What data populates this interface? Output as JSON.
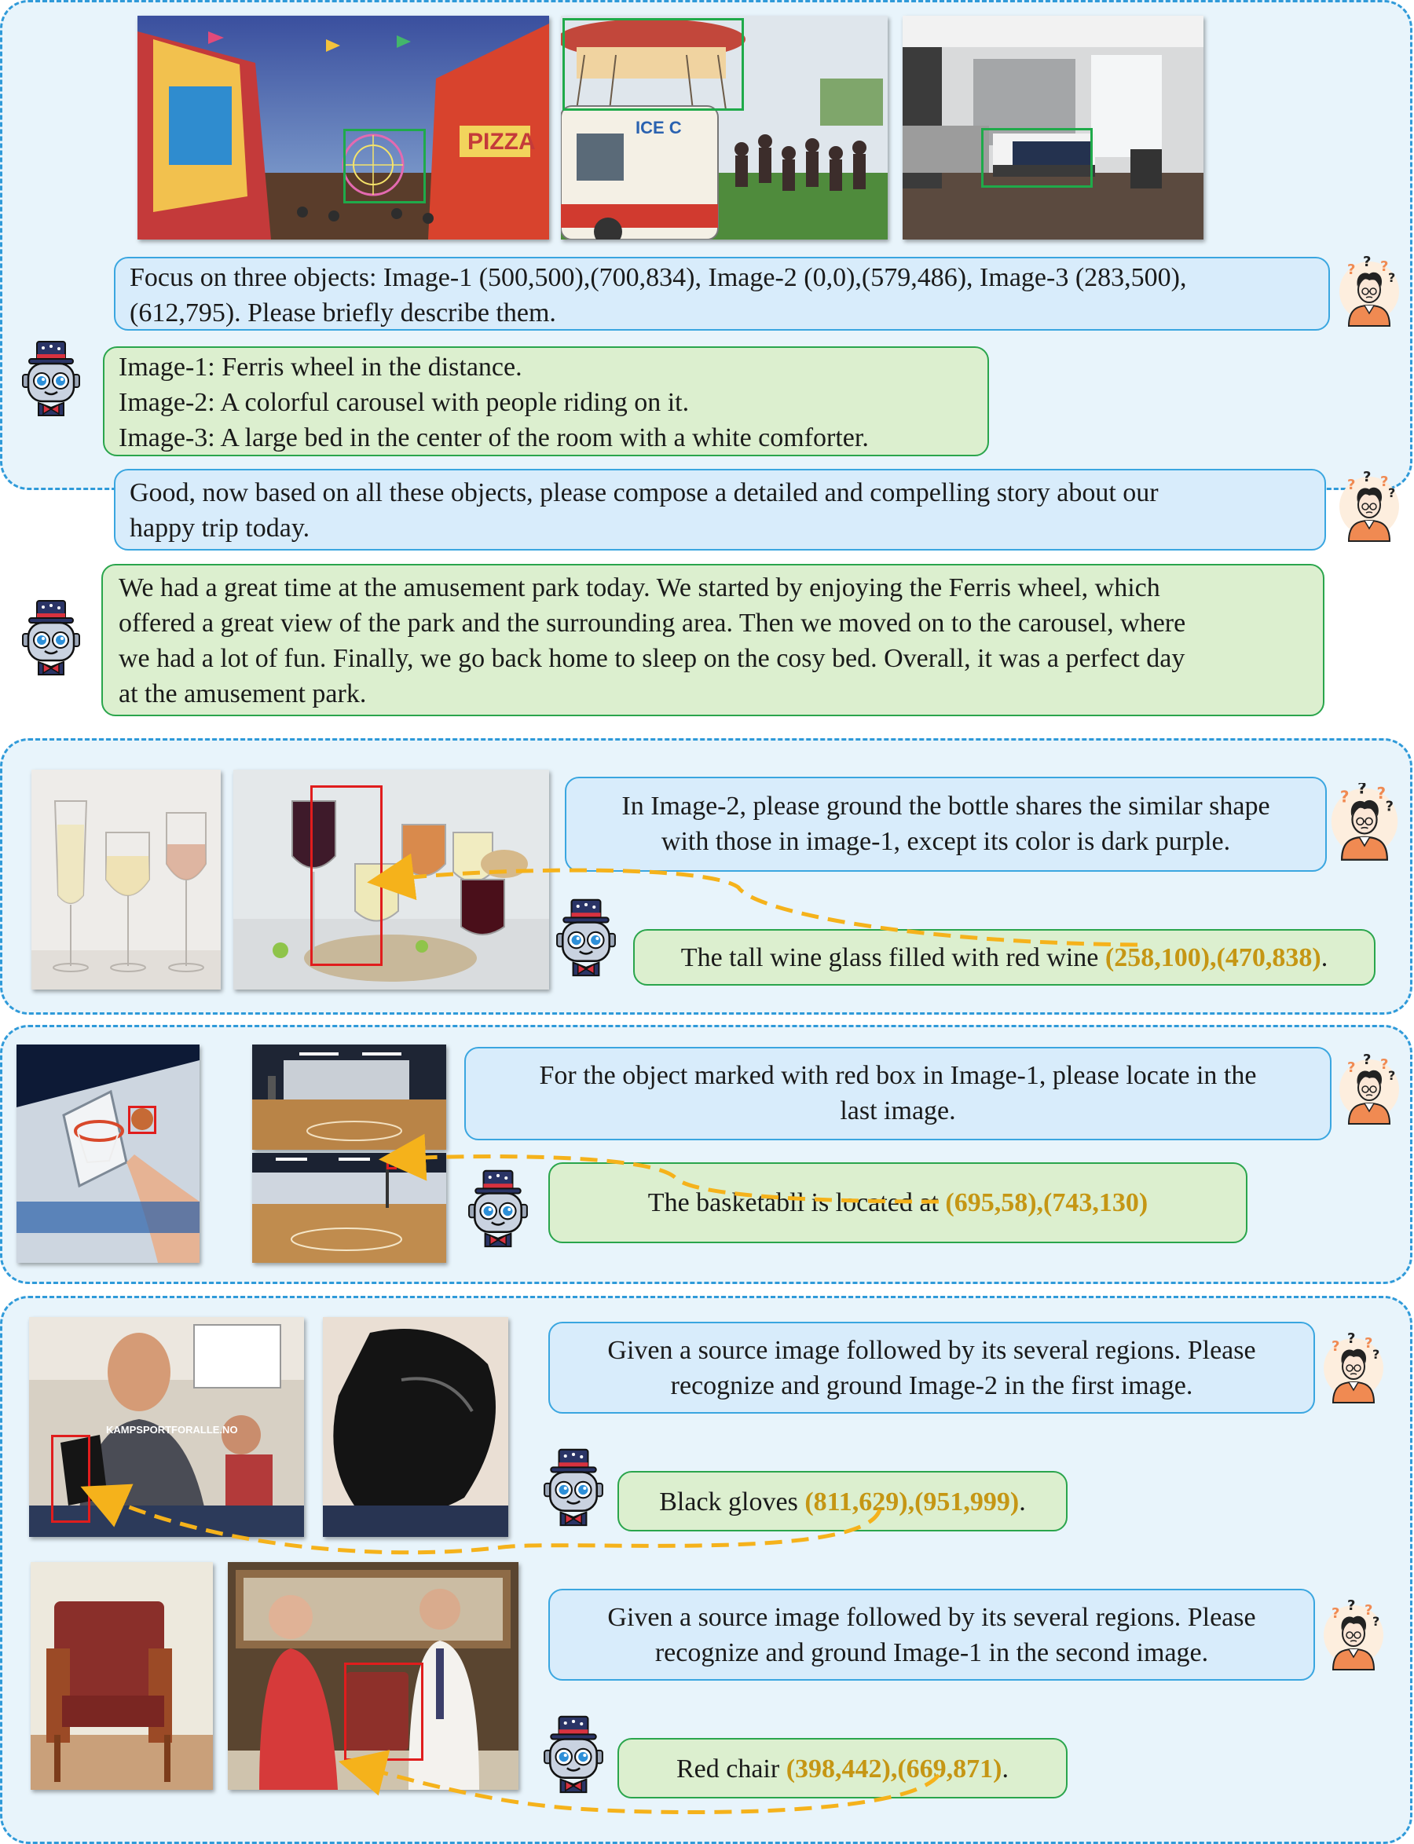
{
  "panel1": {
    "q1": {
      "lines": [
        "Focus on three objects: Image-1 (500,500),(700,834), Image-2 (0,0),(579,486), Image-3 (283,500),",
        "(612,795). Please briefly describe them."
      ]
    },
    "a1": {
      "lines": [
        "Image-1: Ferris wheel in the distance.",
        "Image-2: A colorful carousel with people riding on it.",
        "Image-3: A large bed in the center of the room with a white comforter."
      ]
    },
    "q2": {
      "lines": [
        "Good, now based on all these objects, please compose a detailed and compelling story about our",
        "happy trip today."
      ]
    },
    "a2": {
      "lines": [
        "We had a great time at the amusement park today. We started by enjoying the Ferris wheel, which",
        "offered a great view of the park and the surrounding area. Then we moved on to the carousel, where",
        "we had a lot of fun. Finally, we go back home to sleep on the cosy bed. Overall, it was a perfect day",
        "at the amusement park."
      ]
    }
  },
  "panel2": {
    "q": {
      "lines": [
        "In Image-2, please ground the bottle shares the similar shape",
        "with those in image-1, except its color is dark purple."
      ]
    },
    "a": {
      "text": "The tall wine glass filled with red wine ",
      "coords": "(258,100),(470,838)",
      "suffix": "."
    }
  },
  "panel3": {
    "q": {
      "lines": [
        "For the object marked with red box in Image-1, please locate in the",
        "last image."
      ]
    },
    "a": {
      "text": "The basketabll is located at ",
      "coords": "(695,58),(743,130)"
    }
  },
  "panel4": {
    "q1": {
      "lines": [
        "Given a source image followed by its several regions. Please",
        "recognize and ground Image-2 in the first image."
      ]
    },
    "a1": {
      "text": "Black gloves ",
      "coords": "(811,629),(951,999)",
      "suffix": "."
    },
    "q2": {
      "lines": [
        "Given a source image followed by its several regions. Please",
        "recognize and ground Image-1 in the second image."
      ]
    },
    "a2": {
      "text": "Red chair ",
      "coords": "(398,442),(669,871)",
      "suffix": "."
    },
    "watermark": {
      "lines": [
        "KAMPSPORTFORALLE.NO"
      ]
    }
  },
  "colors": {
    "panel_border": "#2f9ad9",
    "panel_bg": "#e8f4fb",
    "user_bubble": "#d8ecfb",
    "bot_bubble": "#dcefcf",
    "highlight": "#c59614",
    "arrow": "#f5b21b",
    "box_green": "#1faa4a",
    "box_red": "#e01d1d"
  },
  "icons": [
    "user-confused-icon",
    "robot-top-hat-icon"
  ]
}
